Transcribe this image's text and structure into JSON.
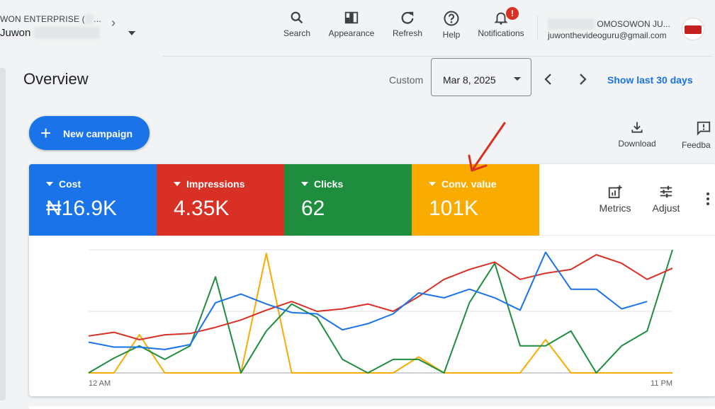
{
  "account": {
    "name_line1": "WON ENTERPRISE (",
    "name_line1_tail": "...",
    "name_line2": "Juwon",
    "redacted_id": "000-000-0000"
  },
  "toolbar": {
    "items": [
      {
        "label": "Search",
        "icon": "search-icon"
      },
      {
        "label": "Appearance",
        "icon": "appearance-icon"
      },
      {
        "label": "Refresh",
        "icon": "refresh-icon"
      },
      {
        "label": "Help",
        "icon": "help-icon"
      },
      {
        "label": "Notifications",
        "icon": "bell-icon",
        "badge": "!"
      }
    ]
  },
  "user": {
    "name": "OMOSOWON JU...",
    "email": "juwonthevideoguru@gmail.com"
  },
  "page": {
    "title": "Overview",
    "custom_label": "Custom",
    "date": "Mar 8, 2025",
    "show_last": "Show last 30 days"
  },
  "actions": {
    "new_campaign": "New campaign",
    "download": "Download",
    "feedback": "Feedba"
  },
  "metrics": [
    {
      "label": "Cost",
      "value": "₦16.9K",
      "color": "#1a73e8"
    },
    {
      "label": "Impressions",
      "value": "4.35K",
      "color": "#d93025"
    },
    {
      "label": "Clicks",
      "value": "62",
      "color": "#1e8e3e"
    },
    {
      "label": "Conv. value",
      "value": "101K",
      "color": "#f9ab00"
    }
  ],
  "card_tools": {
    "metrics": "Metrics",
    "adjust": "Adjust"
  },
  "chart_data": {
    "type": "line",
    "x_start_label": "12 AM",
    "x_end_label": "11 PM",
    "x": [
      0,
      1,
      2,
      3,
      4,
      5,
      6,
      7,
      8,
      9,
      10,
      11,
      12,
      13,
      14,
      15,
      16,
      17,
      18,
      19,
      20,
      21,
      22,
      23
    ],
    "series": [
      {
        "color": "#d93025",
        "values": [
          0.3,
          0.33,
          0.27,
          0.31,
          0.32,
          0.37,
          0.43,
          0.51,
          0.58,
          0.5,
          0.52,
          0.56,
          0.5,
          0.62,
          0.76,
          0.84,
          0.9,
          0.76,
          0.81,
          0.84,
          0.96,
          0.89,
          0.76,
          0.85
        ]
      },
      {
        "color": "#1a73e8",
        "values": [
          0.25,
          0.21,
          0.21,
          0.19,
          0.23,
          0.57,
          0.64,
          0.56,
          0.49,
          0.48,
          0.35,
          0.4,
          0.48,
          0.65,
          0.61,
          0.68,
          0.61,
          0.51,
          0.98,
          0.68,
          0.68,
          0.52,
          0.58,
          null
        ]
      },
      {
        "color": "#1e8e3e",
        "values": [
          0.0,
          0.12,
          0.22,
          0.11,
          0.22,
          0.78,
          0.0,
          0.34,
          0.56,
          0.45,
          0.11,
          0.0,
          0.11,
          0.11,
          0.0,
          0.57,
          0.89,
          0.22,
          0.22,
          0.34,
          0.0,
          0.22,
          0.34,
          1.0
        ]
      },
      {
        "color": "#f9ab00",
        "values": [
          0.0,
          0.0,
          0.31,
          0.0,
          0.0,
          0.0,
          0.0,
          0.97,
          0.0,
          0.0,
          0.0,
          0.0,
          0.0,
          0.13,
          0.0,
          0.0,
          0.0,
          0.0,
          0.27,
          0.0,
          0.0,
          0.0,
          0.0,
          0.0
        ]
      }
    ]
  }
}
